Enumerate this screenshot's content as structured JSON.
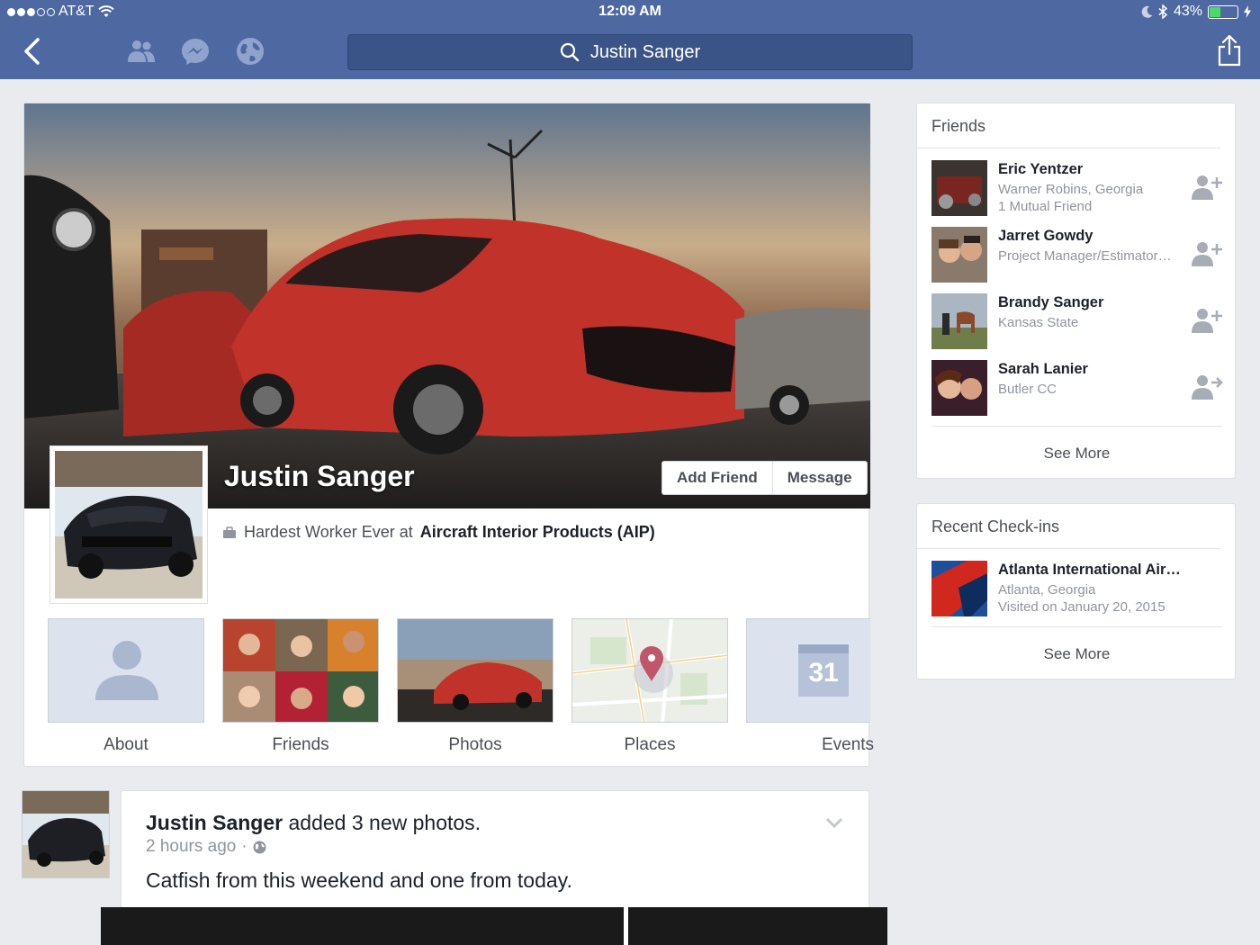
{
  "status_bar": {
    "carrier": "AT&T",
    "time": "12:09 AM",
    "battery": "43%",
    "battery_level": 0.43,
    "icons": [
      "signal-dots-icon",
      "wifi-icon",
      "moon-icon",
      "bluetooth-icon",
      "battery-icon",
      "charging-icon"
    ]
  },
  "nav": {
    "search_value": "Justin Sanger",
    "icons": [
      "back-chevron-icon",
      "friends-icon",
      "messenger-icon",
      "globe-icon",
      "search-icon",
      "share-icon"
    ]
  },
  "profile": {
    "name": "Justin Sanger",
    "add_friend_label": "Add Friend",
    "message_label": "Message",
    "work_prefix": "Hardest Worker Ever at",
    "work_place": "Aircraft Interior Products (AIP)",
    "tiles": [
      {
        "label": "About"
      },
      {
        "label": "Friends"
      },
      {
        "label": "Photos"
      },
      {
        "label": "Places"
      },
      {
        "label": "Events"
      }
    ],
    "events_calendar_day": "31"
  },
  "post": {
    "author": "Justin Sanger",
    "action": "added 3 new photos.",
    "time": "2 hours ago",
    "separator": "·",
    "text": "Catfish from this weekend and one from today."
  },
  "friends_panel": {
    "title": "Friends",
    "items": [
      {
        "name": "Eric Yentzer",
        "line1": "Warner Robins, Georgia",
        "line2": "1 Mutual Friend"
      },
      {
        "name": "Jarret Gowdy",
        "line1": "Project Manager/Estimator…",
        "line2": ""
      },
      {
        "name": "Brandy Sanger",
        "line1": "Kansas State",
        "line2": ""
      },
      {
        "name": "Sarah Lanier",
        "line1": "Butler CC",
        "line2": ""
      }
    ],
    "see_more": "See More"
  },
  "checkins_panel": {
    "title": "Recent Check-ins",
    "items": [
      {
        "name": "Atlanta International Air…",
        "line1": "Atlanta, Georgia",
        "line2": "Visited on January 20, 2015"
      }
    ],
    "see_more": "See More"
  },
  "colors": {
    "nav_blue": "#4e69a2",
    "search_blue": "#3a5487",
    "page_bg": "#e9ebee",
    "battery_green": "#4cd964"
  }
}
